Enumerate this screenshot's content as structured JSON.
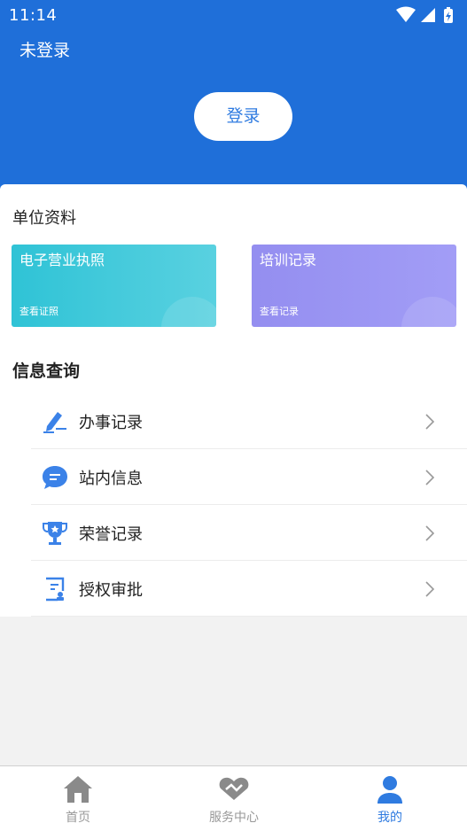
{
  "status_bar": {
    "time": "11:14"
  },
  "header": {
    "user_status": "未登录",
    "login_label": "登录"
  },
  "unit_section": {
    "title": "单位资料",
    "cards": [
      {
        "title": "电子营业执照",
        "subtitle": "查看证照",
        "color": "#2fc3d6"
      },
      {
        "title": "培训记录",
        "subtitle": "查看记录",
        "color": "#948ef0"
      }
    ]
  },
  "info_section": {
    "title": "信息查询",
    "items": [
      {
        "label": "办事记录",
        "icon": "pen-icon"
      },
      {
        "label": "站内信息",
        "icon": "message-icon"
      },
      {
        "label": "荣誉记录",
        "icon": "trophy-icon"
      },
      {
        "label": "授权审批",
        "icon": "approval-icon"
      }
    ]
  },
  "tabbar": {
    "tabs": [
      {
        "label": "首页",
        "icon": "home-icon",
        "active": false
      },
      {
        "label": "服务中心",
        "icon": "handshake-icon",
        "active": false
      },
      {
        "label": "我的",
        "icon": "user-icon",
        "active": true
      }
    ]
  },
  "colors": {
    "primary": "#1f6fd9",
    "accent": "#2f7be0",
    "inactive": "#999999"
  }
}
